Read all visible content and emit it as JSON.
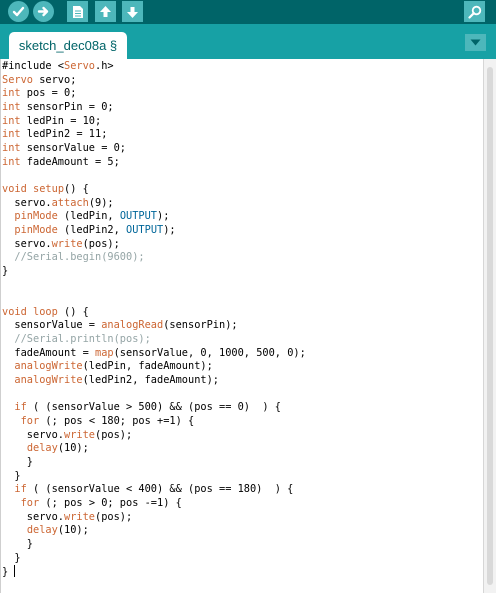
{
  "toolbar": {
    "buttons": [
      {
        "name": "verify",
        "icon": "checkmark-icon"
      },
      {
        "name": "upload",
        "icon": "arrow-right-icon"
      },
      {
        "name": "new",
        "icon": "new-file-icon"
      },
      {
        "name": "open",
        "icon": "arrow-up-icon"
      },
      {
        "name": "save",
        "icon": "arrow-down-icon"
      },
      {
        "name": "serial-monitor",
        "icon": "magnifier-icon"
      }
    ]
  },
  "tabs": [
    {
      "label": "sketch_dec08a §",
      "active": true
    }
  ],
  "tab_menu_icon": "triangle-down-icon",
  "colors": {
    "toolbar": "#006468",
    "tabbar": "#17a1a5",
    "button": "#4db7bb",
    "keyword": "#cc6633",
    "constant": "#006699",
    "comment": "#95a5a6"
  },
  "editor": {
    "lines": [
      "#include <Servo.h>",
      "Servo servo;",
      "int pos = 0;",
      "int sensorPin = 0;",
      "int ledPin = 10;",
      "int ledPin2 = 11;",
      "int sensorValue = 0;",
      "int fadeAmount = 5;",
      "",
      "void setup() {",
      "  servo.attach(9);",
      "  pinMode (ledPin, OUTPUT);",
      "  pinMode (ledPin2, OUTPUT);",
      "  servo.write(pos);",
      "  //Serial.begin(9600);",
      "}",
      "",
      "",
      "void loop () {",
      "  sensorValue = analogRead(sensorPin);",
      "  //Serial.println(pos);",
      "  fadeAmount = map(sensorValue, 0, 1000, 500, 0);",
      "  analogWrite(ledPin, fadeAmount);",
      "  analogWrite(ledPin2, fadeAmount);",
      "",
      "  if ( (sensorValue > 500) && (pos == 0)  ) {",
      "   for (; pos < 180; pos +=1) {",
      "    servo.write(pos);",
      "    delay(10);",
      "    }",
      "  }",
      "  if ( (sensorValue < 400) && (pos == 180)  ) {",
      "   for (; pos > 0; pos -=1) {",
      "    servo.write(pos);",
      "    delay(10);",
      "    }",
      "  }",
      "}"
    ]
  }
}
